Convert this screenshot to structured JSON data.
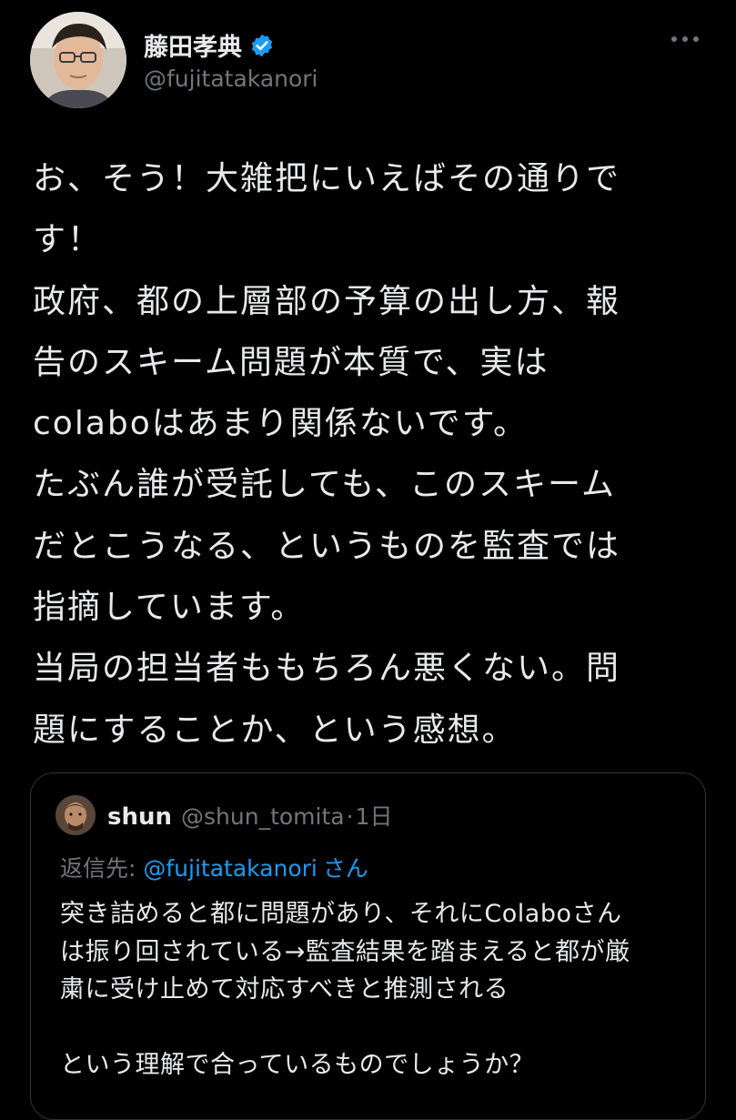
{
  "author": {
    "name": "藤田孝典",
    "handle": "@fujitatakanori",
    "verified_color": "#1d9bf0"
  },
  "tweet": {
    "lines": [
      "お、そう！大雑把にいえばその通りで",
      "す！",
      "政府、都の上層部の予算の出し方、報",
      "告のスキーム問題が本質で、実は",
      "colaboはあまり関係ないです。",
      "たぶん誰が受託しても、このスキーム",
      "だとこうなる、というものを監査では",
      "指摘しています。",
      "当局の担当者ももちろん悪くない。問",
      "題にすることか、という感想。"
    ]
  },
  "quote": {
    "name": "shun",
    "handle": "@shun_tomita",
    "separator": "·",
    "time": "1日",
    "reply_prefix": "返信先: ",
    "reply_mention": "@fujitatakanori",
    "reply_suffix": "さん",
    "lines": [
      "突き詰めると都に問題があり、それにColaboさん",
      "は振り回されている→監査結果を踏まえると都が厳",
      "粛に受け止めて対応すべきと推測される",
      "",
      "という理解で合っているものでしょうか？"
    ]
  },
  "colors": {
    "background": "#000000",
    "text": "#e7e9ea",
    "secondary": "#71767b",
    "accent": "#1d9bf0",
    "border": "#2f3336"
  }
}
